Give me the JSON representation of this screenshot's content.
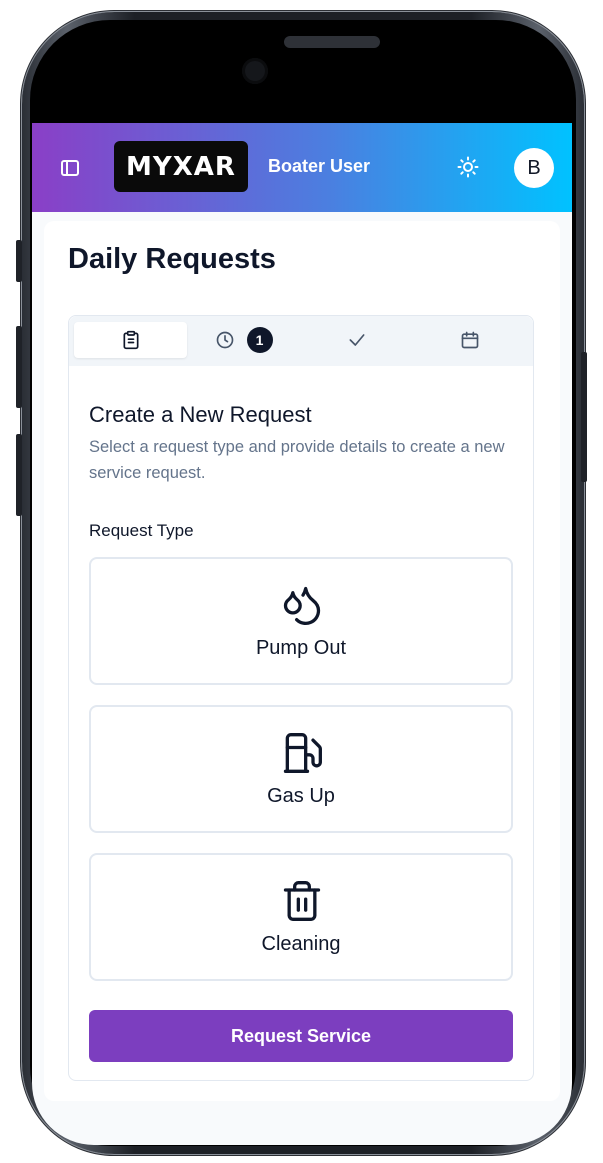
{
  "header": {
    "logo_text": "MYXAR",
    "user_name": "Boater User",
    "avatar_initial": "B",
    "gradient_start": "#8a3fc7",
    "gradient_end": "#00c2ff",
    "icons": {
      "sidebar_toggle": "panel-left-icon",
      "theme_toggle": "sun-icon"
    }
  },
  "page": {
    "title": "Daily Requests"
  },
  "tabs": [
    {
      "name": "new-request",
      "icon": "clipboard-icon",
      "active": true,
      "badge": ""
    },
    {
      "name": "pending",
      "icon": "clock-icon",
      "active": false,
      "badge": "1"
    },
    {
      "name": "completed",
      "icon": "check-icon",
      "active": false,
      "badge": ""
    },
    {
      "name": "scheduled",
      "icon": "calendar-icon",
      "active": false,
      "badge": ""
    }
  ],
  "form": {
    "title": "Create a New Request",
    "description": "Select a request type and provide details to create a new service request.",
    "request_type_label": "Request Type",
    "options": [
      {
        "label": "Pump Out",
        "icon": "droplets-icon"
      },
      {
        "label": "Gas Up",
        "icon": "fuel-pump-icon"
      },
      {
        "label": "Cleaning",
        "icon": "trash-icon"
      }
    ],
    "submit_label": "Request Service",
    "submit_color": "#7c3ebf"
  }
}
